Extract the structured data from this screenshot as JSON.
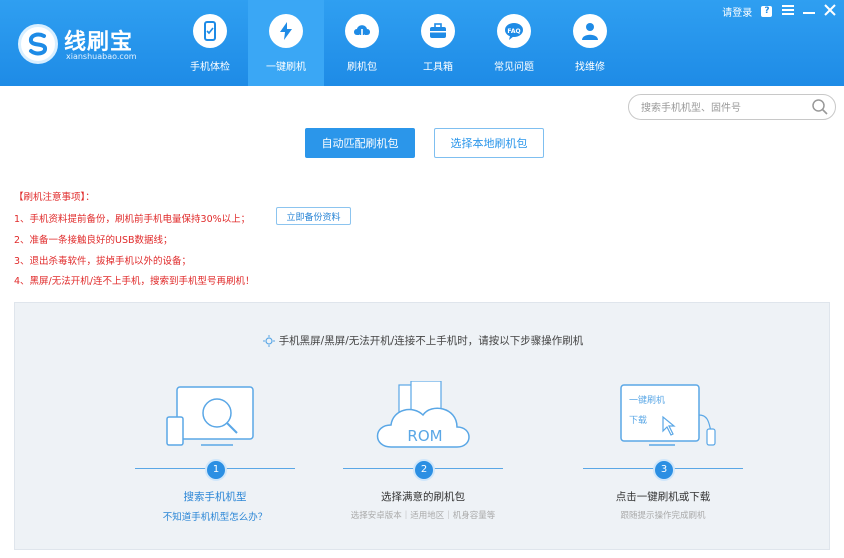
{
  "app": {
    "name": "线刷宝",
    "site": "xianshuabao.com"
  },
  "nav": [
    {
      "label": "手机体检",
      "icon": "phone-check-icon"
    },
    {
      "label": "一键刷机",
      "icon": "lightning-icon"
    },
    {
      "label": "刷机包",
      "icon": "cloud-download-icon"
    },
    {
      "label": "工具箱",
      "icon": "toolbox-icon"
    },
    {
      "label": "常见问题",
      "icon": "faq-icon"
    },
    {
      "label": "找维修",
      "icon": "repair-person-icon"
    }
  ],
  "topbar": {
    "login": "请登录",
    "help": "?"
  },
  "search": {
    "placeholder": "搜索手机机型、固件号"
  },
  "actions": {
    "auto": "自动匹配刷机包",
    "local": "选择本地刷机包"
  },
  "notes": {
    "title": "【刷机注意事项】：",
    "lines": [
      "1、手机资料提前备份，刷机前手机电量保持30%以上；",
      "2、准备一条接触良好的USB数据线；",
      "3、退出杀毒软件，拔掉手机以外的设备；",
      "4、黑屏/无法开机/连不上手机，搜索到手机型号再刷机！"
    ],
    "backup_btn": "立即备份资料"
  },
  "guide": {
    "title": "手机黑屏/黑屏/无法开机/连接不上手机时，请按以下步骤操作刷机",
    "steps": [
      {
        "num": "1",
        "title": "搜索手机机型",
        "sub": "不知道手机机型怎么办？"
      },
      {
        "num": "2",
        "title": "选择满意的刷机包",
        "sub": "选择安卓版本｜适用地区｜机身容量等",
        "art_text": "ROM"
      },
      {
        "num": "3",
        "title": "点击一键刷机或下载",
        "sub": "跟随提示操作完成刷机",
        "art_line1": "一键刷机",
        "art_line2": "下载"
      }
    ]
  },
  "colors": {
    "header": "#1e8be6",
    "accent": "#2b96ea",
    "warning": "#e02a2a"
  }
}
